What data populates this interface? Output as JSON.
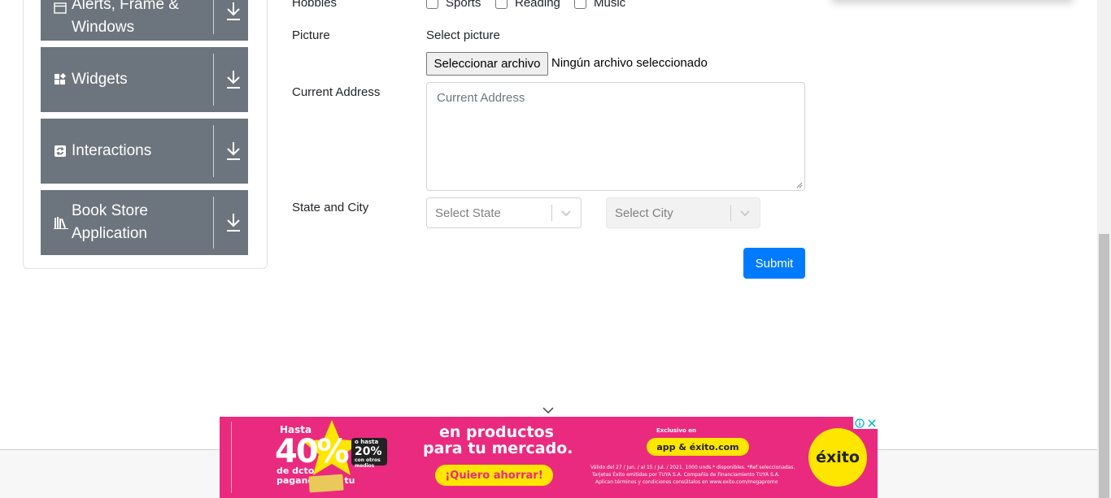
{
  "sidebar": {
    "groups": [
      {
        "label": "Alerts, Frame & Windows",
        "icon": "window-icon"
      },
      {
        "label": "Widgets",
        "icon": "widgets-icon"
      },
      {
        "label": "Interactions",
        "icon": "interactions-icon"
      },
      {
        "label": "Book Store Application",
        "icon": "book-icon"
      }
    ]
  },
  "form": {
    "hobbies": {
      "label": "Hobbies",
      "options": [
        "Sports",
        "Reading",
        "Music"
      ]
    },
    "picture": {
      "label": "Picture",
      "select_label": "Select picture",
      "button": "Seleccionar archivo",
      "status": "Ningún archivo seleccionado"
    },
    "address": {
      "label": "Current Address",
      "placeholder": "Current Address"
    },
    "state_city": {
      "label": "State and City",
      "state_placeholder": "Select State",
      "city_placeholder": "Select City"
    },
    "submit": "Submit"
  },
  "ad": {
    "hasta": "Hasta",
    "percent": "40%",
    "o_hasta": "o hasta",
    "percent2": "20%",
    "otros": "con otros medios",
    "dcto": "de dcto pagando con tu",
    "headline1": "en productos",
    "headline2": "para tu mercado.",
    "cta": "¡Quiero ahorrar!",
    "exclusivo": "Exclusivo en",
    "channels": "app & éxito.com",
    "brand": "éxito",
    "fineprint1": "Válido del 27 / Jun. / al 15 / Jul. / 2021. 1000 unds.* disponibles. *Ref seleccionadas.",
    "fineprint2": "Tarjetas Éxito emitidas por TUYA S.A. Compañía de Financiamiento TUYA S.A.",
    "fineprint3": "Aplican términos y condiciones consúltalos en www.exito.com/megapromo"
  },
  "colors": {
    "sidebar_bg": "#6c757d",
    "primary": "#007bff",
    "ad_bg": "#ea2a7e",
    "ad_yellow": "#ffe600"
  }
}
